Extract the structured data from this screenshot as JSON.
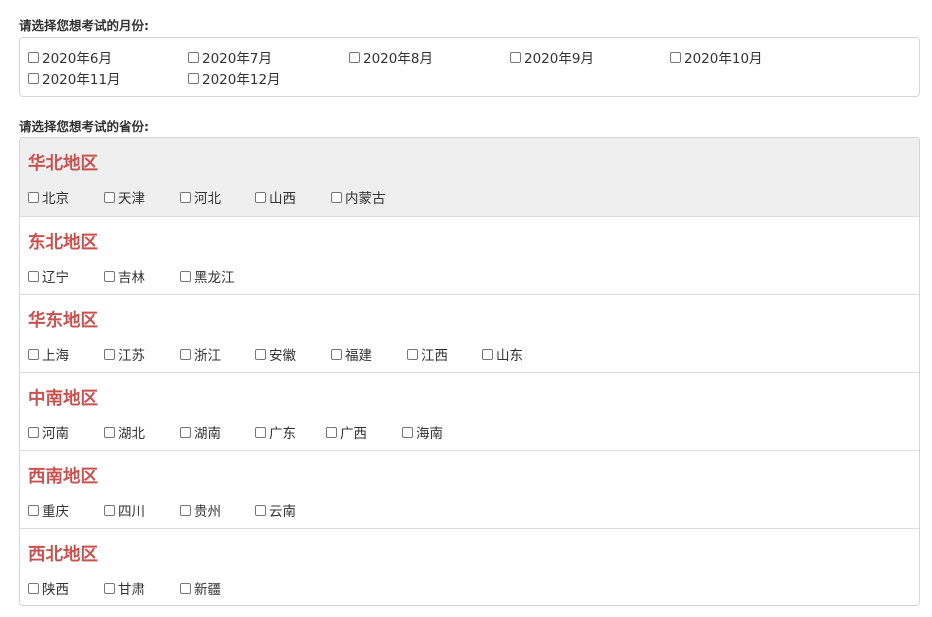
{
  "month_section": {
    "label": "请选择您想考试的月份:",
    "options": [
      "2020年6月",
      "2020年7月",
      "2020年8月",
      "2020年9月",
      "2020年10月",
      "2020年11月",
      "2020年12月"
    ]
  },
  "province_section": {
    "label": "请选择您想考试的省份:",
    "regions": [
      {
        "title": "华北地区",
        "provinces": [
          "北京",
          "天津",
          "河北",
          "山西",
          "内蒙古"
        ]
      },
      {
        "title": "东北地区",
        "provinces": [
          "辽宁",
          "吉林",
          "黑龙江"
        ]
      },
      {
        "title": "华东地区",
        "provinces": [
          "上海",
          "江苏",
          "浙江",
          "安徽",
          "福建",
          "江西",
          "山东"
        ]
      },
      {
        "title": "中南地区",
        "provinces": [
          "河南",
          "湖北",
          "湖南",
          "广东",
          "广西",
          "海南"
        ]
      },
      {
        "title": "西南地区",
        "provinces": [
          "重庆",
          "四川",
          "贵州",
          "云南"
        ]
      },
      {
        "title": "西北地区",
        "provinces": [
          "陕西",
          "甘肃",
          "新疆"
        ]
      }
    ]
  }
}
